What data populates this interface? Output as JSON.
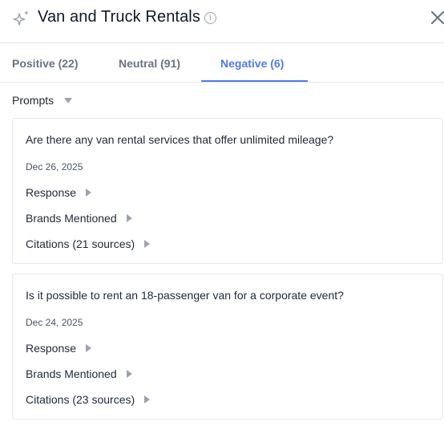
{
  "header": {
    "title": "Van and Truck Rentals",
    "icons": {
      "sparkle": "sparkle-icon",
      "info": "info-icon",
      "close": "close-icon"
    }
  },
  "tabs": [
    {
      "label": "Positive (22)",
      "active": false
    },
    {
      "label": "Neutral (91)",
      "active": false
    },
    {
      "label": "Negative (6)",
      "active": true
    }
  ],
  "filter": {
    "label": "Prompts"
  },
  "prompts": [
    {
      "question": "Are there any van rental services that offer unlimited mileage?",
      "date": "Dec 26, 2025",
      "response_label": "Response",
      "brands_label": "Brands Mentioned",
      "citations_label": "Citations (21 sources)"
    },
    {
      "question": "Is it possible to rent an 18-passenger van for a corporate event?",
      "date": "Dec 24, 2025",
      "response_label": "Response",
      "brands_label": "Brands Mentioned",
      "citations_label": "Citations (23 sources)"
    }
  ],
  "colors": {
    "accent": "#4f7ae8",
    "muted": "#6b7280",
    "border": "#e5e7eb"
  }
}
